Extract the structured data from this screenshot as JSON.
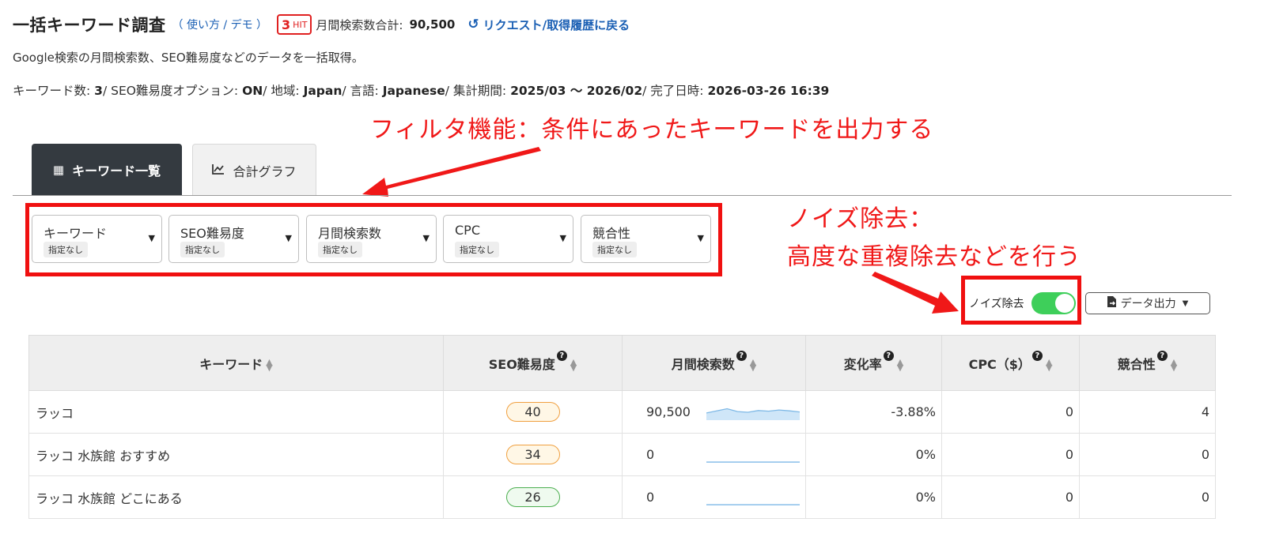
{
  "header": {
    "title": "一括キーワード調査",
    "howto_link": "（ 使い方 / デモ ）",
    "hit_count": "3",
    "hit_label": "HIT",
    "total_label": "月間検索数合計:",
    "total_value": "90,500",
    "back_link": "リクエスト/取得履歴に戻る"
  },
  "description": "Google検索の月間検索数、SEO難易度などのデータを一括取得。",
  "meta": {
    "kw_count_label": "キーワード数: ",
    "kw_count": "3",
    "seo_opt_label": "/ SEO難易度オプション: ",
    "seo_opt": "ON",
    "region_label": "/ 地域: ",
    "region": "Japan",
    "lang_label": "/ 言語: ",
    "lang": "Japanese",
    "period_label": "/ 集計期間: ",
    "period": "2025/03 〜 2026/02",
    "done_label": "/ 完了日時: ",
    "done": "2026-03-26 16:39"
  },
  "annotations": {
    "filter_note": "フィルタ機能：条件にあったキーワードを出力する",
    "noise_note_1": "ノイズ除去：",
    "noise_note_2": "高度な重複除去などを行う",
    "color": "#f01818"
  },
  "tabs": [
    {
      "label": "キーワード一覧",
      "icon": "table-icon",
      "active": true
    },
    {
      "label": "合計グラフ",
      "icon": "line-chart-icon",
      "active": false
    }
  ],
  "filters": [
    {
      "label": "キーワード",
      "value": "指定なし"
    },
    {
      "label": "SEO難易度",
      "value": "指定なし"
    },
    {
      "label": "月間検索数",
      "value": "指定なし"
    },
    {
      "label": "CPC",
      "value": "指定なし"
    },
    {
      "label": "競合性",
      "value": "指定なし"
    }
  ],
  "noise": {
    "label": "ノイズ除去",
    "enabled": true,
    "color": "#3ecf5a"
  },
  "export": {
    "label": "データ出力"
  },
  "table": {
    "columns": [
      "キーワード",
      "SEO難易度",
      "月間検索数",
      "変化率",
      "CPC（$）",
      "競合性"
    ],
    "rows": [
      {
        "keyword": "ラッコ",
        "seo": "40",
        "seo_level": "orange",
        "volume": "90,500",
        "change": "-3.88%",
        "change_negative": true,
        "cpc": "0",
        "competition": "4",
        "trend": [
          0.45,
          0.6,
          0.75,
          0.55,
          0.5,
          0.62,
          0.58,
          0.66,
          0.6,
          0.52
        ]
      },
      {
        "keyword": "ラッコ 水族館 おすすめ",
        "seo": "34",
        "seo_level": "orange",
        "volume": "0",
        "change": "0%",
        "change_negative": false,
        "cpc": "0",
        "competition": "0",
        "trend": [
          0,
          0,
          0,
          0,
          0,
          0,
          0,
          0,
          0,
          0
        ]
      },
      {
        "keyword": "ラッコ 水族館 どこにある",
        "seo": "26",
        "seo_level": "green",
        "volume": "0",
        "change": "0%",
        "change_negative": false,
        "cpc": "0",
        "competition": "0",
        "trend": [
          0,
          0,
          0,
          0,
          0,
          0,
          0,
          0,
          0,
          0
        ]
      }
    ]
  }
}
